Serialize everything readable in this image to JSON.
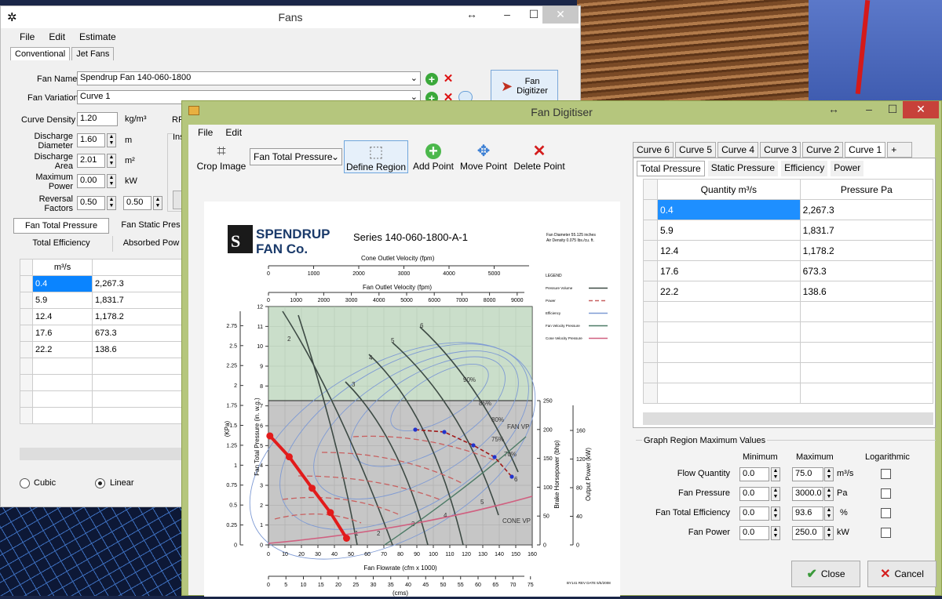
{
  "fans_window": {
    "title": "Fans",
    "menu": [
      "File",
      "Edit",
      "Estimate"
    ],
    "tabs": [
      "Conventional",
      "Jet Fans"
    ],
    "fan_name_label": "Fan Name",
    "fan_name_value": "Spendrup Fan 140-060-1800",
    "fan_variation_label": "Fan Variation",
    "fan_variation_value": "Curve 1",
    "curve_density_label": "Curve Density",
    "curve_density_value": "1.20",
    "curve_density_unit": "kg/m³",
    "rpm_label": "RP",
    "discharge_diameter_label": "Discharge Diameter",
    "discharge_diameter_value": "1.60",
    "discharge_diameter_unit": "m",
    "discharge_area_label": "Discharge Area",
    "discharge_area_value": "2.01",
    "discharge_area_unit": "m²",
    "max_power_label": "Maximum Power",
    "max_power_value": "0.00",
    "max_power_unit": "kW",
    "reversal_label": "Reversal Factors",
    "reversal_value1": "0.50",
    "reversal_value2": "0.50",
    "inst_label": "Ins",
    "fan_digitizer_button": "Fan Digitizer",
    "curve_tabs": [
      "Fan Total Pressure",
      "Fan Static Pres",
      "Total Efficiency",
      "Absorbed Pow"
    ],
    "table_header": "m³/s",
    "table_rows": [
      [
        "0.4",
        "2,267.3"
      ],
      [
        "5.9",
        "1,831.7"
      ],
      [
        "12.4",
        "1,178.2"
      ],
      [
        "17.6",
        "673.3"
      ],
      [
        "22.2",
        "138.6"
      ]
    ],
    "interp_cubic": "Cubic",
    "interp_linear": "Linear"
  },
  "digitiser": {
    "title": "Fan Digitiser",
    "menu": [
      "File",
      "Edit"
    ],
    "toolbar": {
      "crop": "Crop Image",
      "select_value": "Fan Total Pressure",
      "define": "Define Region",
      "add": "Add Point",
      "move": "Move Point",
      "delete": "Delete Point"
    },
    "curve_tabs": [
      "Curve 6",
      "Curve 5",
      "Curve 4",
      "Curve 3",
      "Curve 2",
      "Curve 1",
      "+"
    ],
    "sub_tabs": [
      "Total Pressure",
      "Static Pressure",
      "Efficiency",
      "Power"
    ],
    "table_headers": [
      "Quantity m³/s",
      "Pressure Pa"
    ],
    "table_rows": [
      [
        "0.4",
        "2,267.3"
      ],
      [
        "5.9",
        "1,831.7"
      ],
      [
        "12.4",
        "1,178.2"
      ],
      [
        "17.6",
        "673.3"
      ],
      [
        "22.2",
        "138.6"
      ]
    ],
    "region": {
      "title": "Graph Region Maximum Values",
      "col_min": "Minimum",
      "col_max": "Maximum",
      "col_log": "Logarithmic",
      "rows": [
        {
          "label": "Flow Quantity",
          "min": "0.0",
          "max": "75.0",
          "unit": "m³/s"
        },
        {
          "label": "Fan Pressure",
          "min": "0.0",
          "max": "3000.0",
          "unit": "Pa"
        },
        {
          "label": "Fan Total Efficiency",
          "min": "0.0",
          "max": "93.6",
          "unit": "%"
        },
        {
          "label": "Fan Power",
          "min": "0.0",
          "max": "250.0",
          "unit": "kW"
        }
      ]
    },
    "close_button": "Close",
    "cancel_button": "Cancel"
  },
  "chart_image": {
    "logo_line1": "SPENDRUP",
    "logo_line2": "FAN Co.",
    "series_title": "Series 140-060-1800-A-1",
    "note1": "Fan Diameter 55.125 inches",
    "note2": "Air Density 0.075 lbs./cu. ft.",
    "top_axis1": "Cone Outlet Velocity (fpm)",
    "top_axis1_ticks": [
      "0",
      "1000",
      "2000",
      "3000",
      "4000",
      "5000"
    ],
    "top_axis2": "Fan Outlet Velocity (fpm)",
    "top_axis2_ticks": [
      "0",
      "1000",
      "2000",
      "3000",
      "4000",
      "5000",
      "6000",
      "7000",
      "8000",
      "9000"
    ],
    "y_label_inwg": "Fan Total Pressure (in. w.g.)",
    "y_label_kpa": "(KPa)",
    "y_ticks_inwg": [
      "0",
      "1",
      "2",
      "3",
      "4",
      "5",
      "6",
      "7",
      "8",
      "9",
      "10",
      "11",
      "12"
    ],
    "y_ticks_kpa": [
      "0",
      "0.25",
      "0.5",
      "0.75",
      "1",
      "1.25",
      "1.5",
      "1.75",
      "2",
      "2.25",
      "2.5",
      "2.75"
    ],
    "x_label": "Fan Flowrate (cfm x 1000)",
    "x_ticks": [
      "0",
      "10",
      "20",
      "30",
      "40",
      "50",
      "60",
      "70",
      "80",
      "90",
      "100",
      "110",
      "120",
      "130",
      "140",
      "150",
      "160"
    ],
    "x2_label": "(cms)",
    "x2_ticks": [
      "0",
      "5",
      "10",
      "15",
      "20",
      "25",
      "30",
      "35",
      "40",
      "45",
      "50",
      "55",
      "60",
      "65",
      "70",
      "75"
    ],
    "bhp_label": "Brake Horsepower (bhp)",
    "bhp_ticks": [
      "0",
      "50",
      "100",
      "150",
      "200",
      "250"
    ],
    "kw_label": "Output Power (kW)",
    "kw_ticks": [
      "0",
      "40",
      "80",
      "120",
      "160"
    ],
    "legend_title": "LEGEND",
    "legend_items": [
      "Pressure Volume",
      "Power",
      "Efficiency",
      "Fan Velocity Pressure",
      "Cone Velocity Pressure"
    ],
    "curve_labels": [
      "1",
      "2",
      "3",
      "4",
      "5",
      "6"
    ],
    "eff_labels": [
      "90%",
      "85%",
      "80%",
      "75%",
      "70%"
    ],
    "fan_vp": "FAN VP",
    "cone_vp": "CONE VP",
    "footer": "BY141 REV DATE 5/5/2008",
    "colors": {
      "pressure_points": "#e21b1b",
      "power_points": "#2233cc",
      "power_line": "#a01818",
      "region_fill": "#7fa07f"
    }
  }
}
